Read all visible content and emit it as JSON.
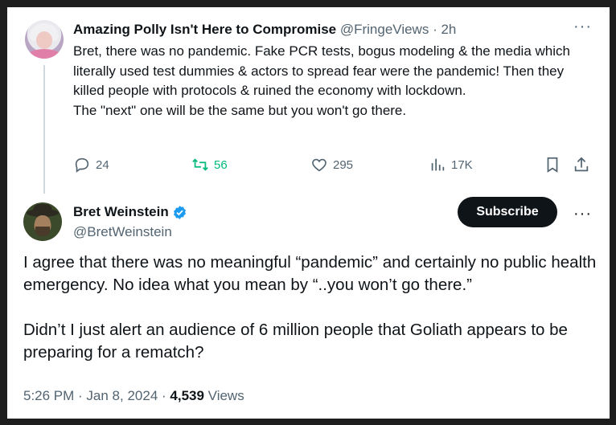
{
  "reply": {
    "name": "Amazing Polly Isn't Here to Compromise",
    "handle": "@FringeViews",
    "separator": "·",
    "time": "2h",
    "more": "···",
    "text": "Bret, there was no pandemic. Fake PCR tests, bogus modeling & the media which literally used test dummies & actors to spread fear were the pandemic! Then they killed people with protocols & ruined the economy with lockdown.\nThe \"next\" one will be the same but you won't go there.",
    "actions": {
      "replies": "24",
      "reposts": "56",
      "likes": "295",
      "views": "17K"
    },
    "colors": {
      "repost": "#00ba7c",
      "muted": "#536471"
    }
  },
  "main": {
    "name": "Bret Weinstein",
    "handle": "@BretWeinstein",
    "subscribe_label": "Subscribe",
    "more": "···",
    "paragraph1": "I agree that there was no meaningful “pandemic” and certainly no public health emergency. No idea what you mean by “..you won’t go there.”",
    "paragraph2": "Didn’t I just alert an audience of 6 million people that Goliath appears to be preparing for a rematch?",
    "timestamp": "5:26 PM · Jan 8, 2024 · ",
    "views_count": "4,539",
    "views_label": " Views",
    "colors": {
      "verified": "#1d9bf0",
      "text": "#0f1419"
    }
  }
}
